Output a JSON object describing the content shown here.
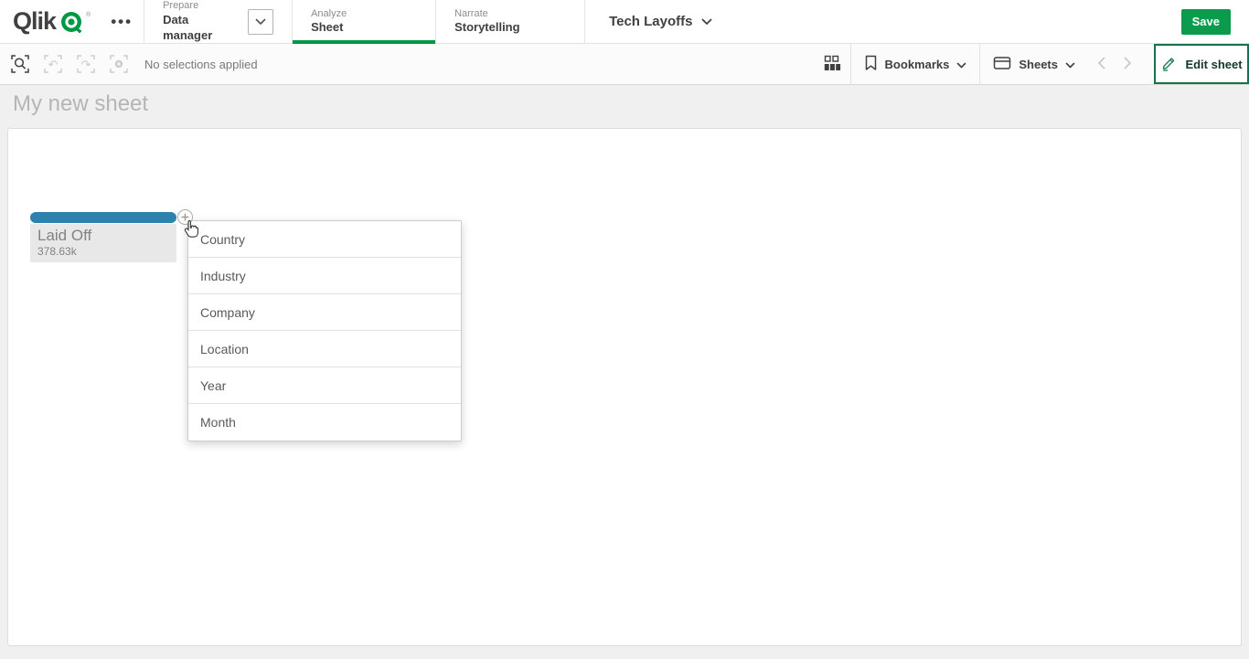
{
  "topbar": {
    "logo": "Qlik",
    "registered_mark": "®",
    "nav": [
      {
        "section": "Prepare",
        "label": "Data manager"
      },
      {
        "section": "Analyze",
        "label": "Sheet"
      },
      {
        "section": "Narrate",
        "label": "Storytelling"
      }
    ],
    "app_title": "Tech Layoffs",
    "save_label": "Save"
  },
  "toolbar": {
    "status_text": "No selections applied",
    "bookmarks_label": "Bookmarks",
    "sheets_label": "Sheets",
    "edit_sheet_label": "Edit sheet"
  },
  "sheet": {
    "title": "My new sheet",
    "kpi": {
      "label": "Laid Off",
      "value": "378.63k"
    },
    "field_menu": {
      "items": [
        "Country",
        "Industry",
        "Company",
        "Location",
        "Year",
        "Month"
      ]
    }
  },
  "colors": {
    "brand_green": "#009845",
    "save_green": "#0a9b4c",
    "edit_border_green": "#17714a",
    "selection_blue": "#2c82ac"
  }
}
